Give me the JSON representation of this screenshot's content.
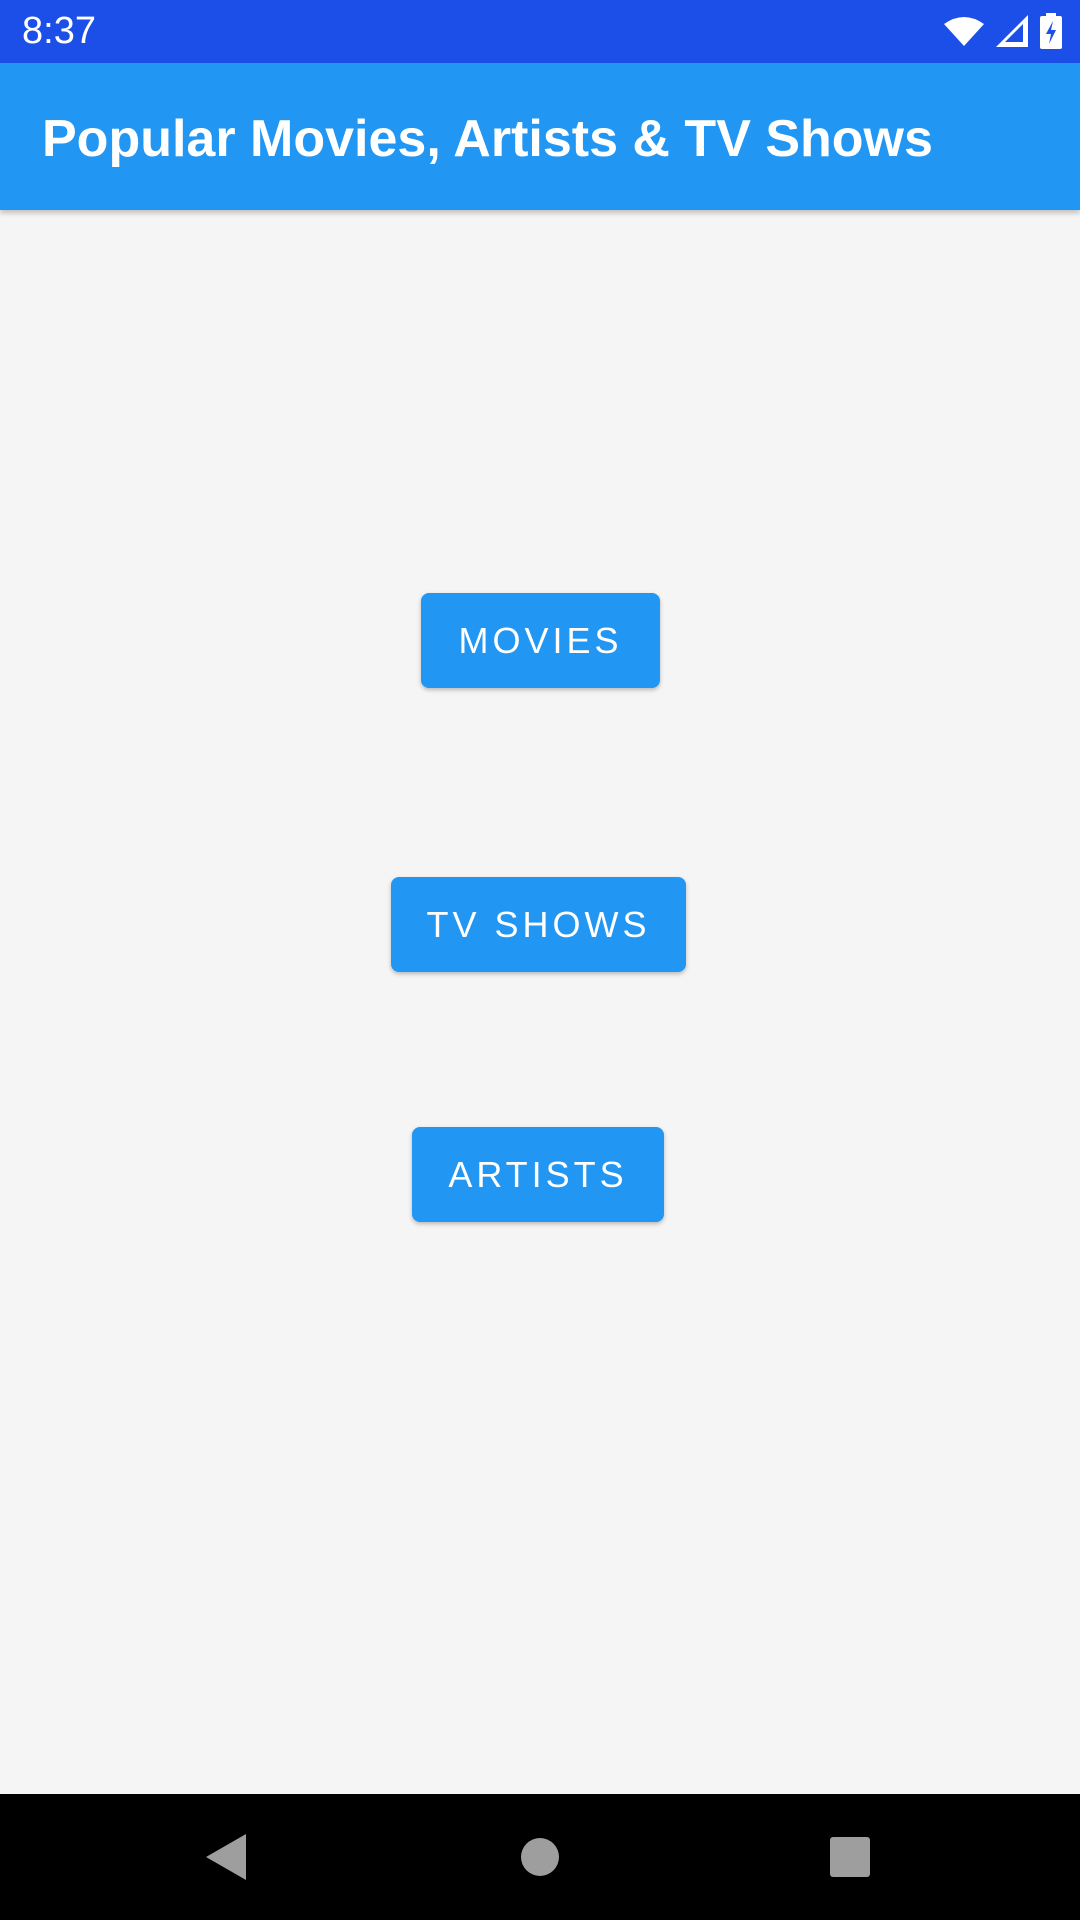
{
  "status_bar": {
    "time": "8:37",
    "icons": [
      "wifi-icon",
      "signal-icon",
      "battery-charging-icon"
    ],
    "background": "#1b4fe8"
  },
  "app_bar": {
    "title": "Popular Movies, Artists & TV Shows",
    "background": "#2196f3"
  },
  "buttons": {
    "movies": "MOVIES",
    "tv_shows": "TV SHOWS",
    "artists": "ARTISTS",
    "color": "#2196f3"
  },
  "nav_bar": {
    "icons": [
      "back-icon",
      "home-icon",
      "recents-icon"
    ]
  }
}
